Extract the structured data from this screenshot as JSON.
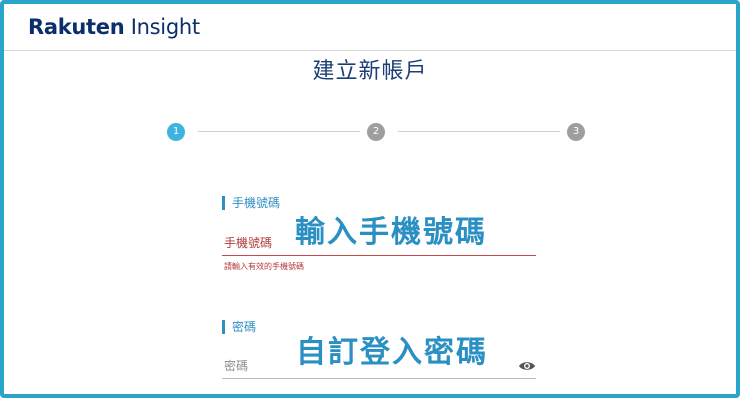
{
  "brand": {
    "name_bold": "Rakuten",
    "name_light": " Insight"
  },
  "page": {
    "title": "建立新帳戶"
  },
  "stepper": {
    "steps": [
      "1",
      "2",
      "3"
    ],
    "current": 1
  },
  "phone": {
    "section_label": "手機號碼",
    "field_label": "手機號碼",
    "error": "請輸入有效的手機號碼",
    "overlay_note": "輸入手機號碼"
  },
  "password": {
    "section_label": "密碼",
    "field_label": "密碼",
    "overlay_note": "自訂登入密碼"
  },
  "icons": {
    "password_toggle": "eye-icon"
  },
  "colors": {
    "frame": "#2aa5c9",
    "brand": "#0b2f6b",
    "step_active": "#3fb3e0",
    "step_inactive": "#9e9e9e",
    "error": "#b33a3a",
    "overlay": "#2a8fc3"
  }
}
